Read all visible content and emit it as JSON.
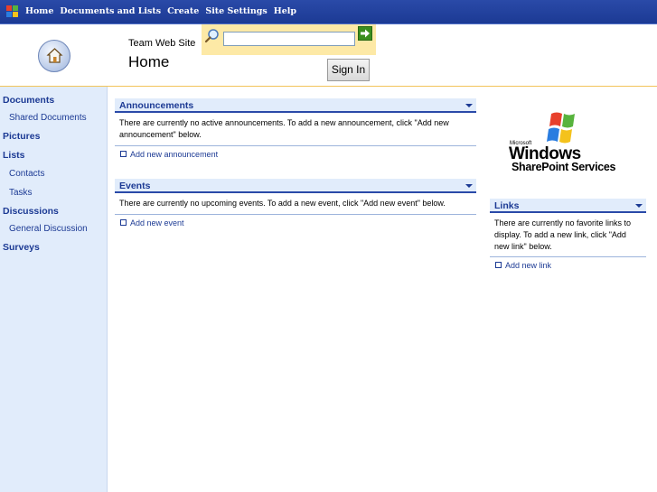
{
  "topnav": {
    "items": [
      "Home",
      "Documents and Lists",
      "Create",
      "Site Settings",
      "Help"
    ]
  },
  "header": {
    "site_title": "Team Web Site",
    "page_title": "Home",
    "search_placeholder": "",
    "sign_in_label": "Sign In"
  },
  "leftnav": {
    "documents": "Documents",
    "shared_documents": "Shared Documents",
    "pictures": "Pictures",
    "lists": "Lists",
    "contacts": "Contacts",
    "tasks": "Tasks",
    "discussions": "Discussions",
    "general_discussion": "General Discussion",
    "surveys": "Surveys"
  },
  "announcements": {
    "title": "Announcements",
    "body_line1": "There are currently no active announcements. To add a new announcement, click \"Add new",
    "body_line2": "announcement\" below.",
    "add_link": "Add new announcement"
  },
  "events": {
    "title": "Events",
    "body": "There are currently no upcoming events. To add a new event, click \"Add new event\" below.",
    "add_link": "Add new event"
  },
  "links": {
    "title": "Links",
    "body_line1": "There are currently no favorite links to",
    "body_line2": "display. To add a new link, click \"Add",
    "body_line3": "new link\" below.",
    "add_link": "Add new link"
  },
  "logo": {
    "microsoft": "Microsoft",
    "windows": "Windows",
    "sharepoint_services": "SharePoint Services"
  },
  "colors": {
    "nav_blue": "#1c3a94",
    "panel_blue": "#e1ecfb",
    "search_yellow": "#fde9a6"
  }
}
